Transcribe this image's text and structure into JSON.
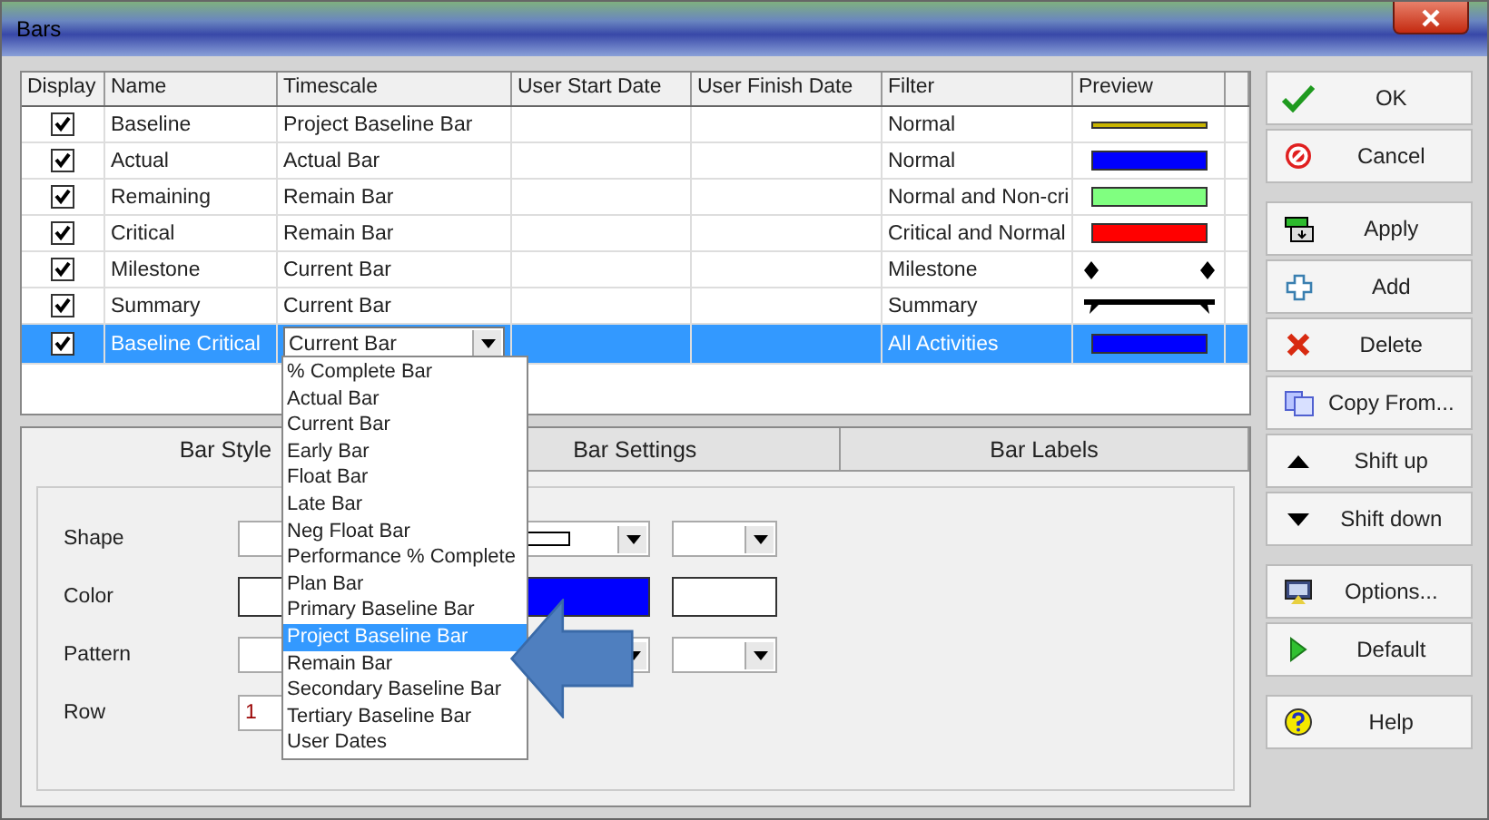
{
  "window": {
    "title": "Bars"
  },
  "table": {
    "columns": [
      "Display",
      "Name",
      "Timescale",
      "User Start Date",
      "User Finish Date",
      "Filter",
      "Preview"
    ],
    "rows": [
      {
        "display": true,
        "name": "Baseline",
        "timescale": "Project Baseline Bar",
        "filter": "Normal",
        "preview": {
          "kind": "line",
          "color": "#c8b400"
        },
        "selected": false
      },
      {
        "display": true,
        "name": "Actual",
        "timescale": "Actual Bar",
        "filter": "Normal",
        "preview": {
          "kind": "bar",
          "color": "#0000ff"
        },
        "selected": false
      },
      {
        "display": true,
        "name": "Remaining",
        "timescale": "Remain Bar",
        "filter": "Normal and Non-cri",
        "preview": {
          "kind": "bar",
          "color": "#80ff80"
        },
        "selected": false
      },
      {
        "display": true,
        "name": "Critical",
        "timescale": "Remain Bar",
        "filter": "Critical and Normal",
        "preview": {
          "kind": "bar",
          "color": "#ff0000"
        },
        "selected": false
      },
      {
        "display": true,
        "name": "Milestone",
        "timescale": "Current Bar",
        "filter": "Milestone",
        "preview": {
          "kind": "milestone",
          "color": "#000000"
        },
        "selected": false
      },
      {
        "display": true,
        "name": "Summary",
        "timescale": "Current Bar",
        "filter": "Summary",
        "preview": {
          "kind": "summary",
          "color": "#000000"
        },
        "selected": false
      },
      {
        "display": true,
        "name": "Baseline Critical",
        "timescale": "Current Bar",
        "filter": "All Activities",
        "preview": {
          "kind": "bar",
          "color": "#0000ff"
        },
        "selected": true
      }
    ]
  },
  "timescale_dropdown": {
    "options": [
      {
        "label": "% Complete Bar",
        "selected": false
      },
      {
        "label": "Actual Bar",
        "selected": false
      },
      {
        "label": "Current Bar",
        "selected": false
      },
      {
        "label": "Early Bar",
        "selected": false
      },
      {
        "label": "Float Bar",
        "selected": false
      },
      {
        "label": "Late Bar",
        "selected": false
      },
      {
        "label": "Neg Float Bar",
        "selected": false
      },
      {
        "label": "Performance % Complete",
        "selected": false
      },
      {
        "label": "Plan Bar",
        "selected": false
      },
      {
        "label": "Primary Baseline Bar",
        "selected": false
      },
      {
        "label": "Project Baseline Bar",
        "selected": true
      },
      {
        "label": "Remain Bar",
        "selected": false
      },
      {
        "label": "Secondary Baseline Bar",
        "selected": false
      },
      {
        "label": "Tertiary Baseline Bar",
        "selected": false
      },
      {
        "label": "User Dates",
        "selected": false
      }
    ]
  },
  "tabs": [
    {
      "label": "Bar Style",
      "selected": true
    },
    {
      "label": "Bar Settings",
      "selected": false
    },
    {
      "label": "Bar Labels",
      "selected": false
    }
  ],
  "bar_style": [
    {
      "label": "Shape",
      "kind": "combo"
    },
    {
      "label": "Color",
      "kind": "color",
      "color": "#0000ff"
    },
    {
      "label": "Pattern",
      "kind": "combo"
    },
    {
      "label": "Row",
      "kind": "input",
      "value": "1"
    }
  ],
  "button_groups": [
    [
      "OK",
      "Cancel"
    ],
    [
      "Apply",
      "Add",
      "Delete",
      "Copy From...",
      "Shift up",
      "Shift down"
    ],
    [
      "Options...",
      "Default"
    ],
    [
      "Help"
    ]
  ]
}
